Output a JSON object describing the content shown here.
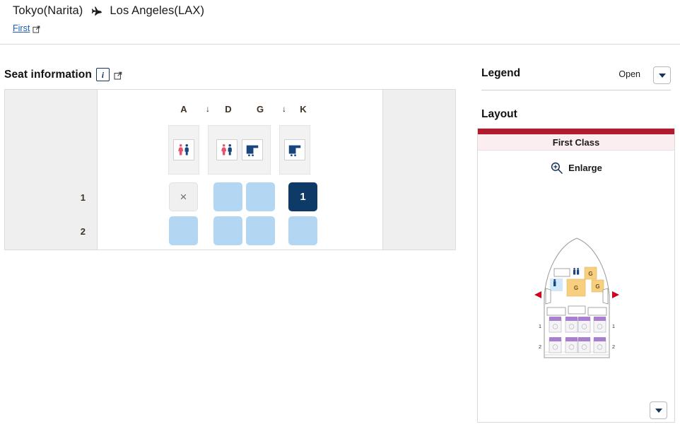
{
  "route": {
    "origin": "Tokyo(Narita)",
    "destination": "Los Angeles(LAX)",
    "plane_icon": "airplane-icon",
    "cabin_link": "First",
    "cabin_link_icon": "external-link-icon"
  },
  "seat_information": {
    "title": "Seat information",
    "info_icon": "info-icon",
    "external_icon": "external-link-icon",
    "columns": [
      "A",
      "↓",
      "D",
      "G",
      "↓",
      "K"
    ],
    "row_numbers": [
      "1",
      "2"
    ],
    "facilities": [
      {
        "name": "lavatory-galley-block-left",
        "icons": [
          "lavatory-icon"
        ]
      },
      {
        "name": "lavatory-galley-block-center",
        "icons": [
          "lavatory-icon",
          "galley-icon"
        ]
      },
      {
        "name": "galley-block-right",
        "icons": [
          "galley-icon"
        ]
      }
    ],
    "seats": [
      {
        "row": "1",
        "column": "A",
        "state": "occupied",
        "label": "×"
      },
      {
        "row": "1",
        "column": "D",
        "state": "available",
        "label": ""
      },
      {
        "row": "1",
        "column": "G",
        "state": "available",
        "label": ""
      },
      {
        "row": "1",
        "column": "K",
        "state": "selected",
        "label": "1"
      },
      {
        "row": "2",
        "column": "A",
        "state": "available",
        "label": ""
      },
      {
        "row": "2",
        "column": "D",
        "state": "available",
        "label": ""
      },
      {
        "row": "2",
        "column": "G",
        "state": "available",
        "label": ""
      },
      {
        "row": "2",
        "column": "K",
        "state": "available",
        "label": ""
      }
    ]
  },
  "legend": {
    "title": "Legend",
    "state_label": "Open",
    "toggle_icon": "chevron-down-icon"
  },
  "layout": {
    "title": "Layout",
    "cabin_class": "First Class",
    "enlarge_label": "Enlarge",
    "enlarge_icon": "zoom-in-icon",
    "accent_color": "#b01b2e",
    "diagram": {
      "name": "aircraft-cabin-diagram",
      "galley_labels": [
        "G",
        "G",
        "G"
      ],
      "row_labels_left": [
        "1",
        "2"
      ],
      "row_labels_right": [
        "1",
        "2"
      ],
      "door_markers": [
        "left-door-marker",
        "right-door-marker"
      ],
      "lavatory_icons": [
        "lavatory-icon",
        "lavatory-icon"
      ]
    },
    "scroll_icon": "chevron-down-icon"
  },
  "colors": {
    "seat_available": "#b3d6f2",
    "seat_selected": "#0d3a66",
    "seat_occupied": "#f0f0f0",
    "cabin_accent": "#b01b2e",
    "link": "#1a5fb4"
  }
}
